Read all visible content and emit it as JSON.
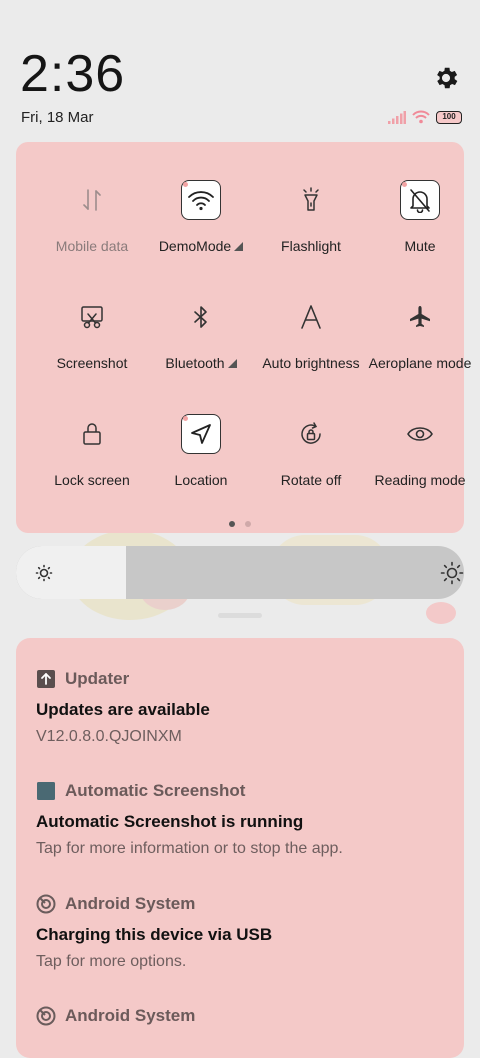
{
  "header": {
    "time": "2:36",
    "date": "Fri, 18 Mar",
    "battery_level": "100"
  },
  "quick_settings": {
    "tiles": [
      {
        "label": "Mobile data",
        "icon": "mobile-data-icon",
        "active": false,
        "dim": true,
        "expandable": false
      },
      {
        "label": "DemoMode",
        "icon": "wifi-icon",
        "active": true,
        "dim": false,
        "expandable": true
      },
      {
        "label": "Flashlight",
        "icon": "flashlight-icon",
        "active": false,
        "dim": false,
        "expandable": false
      },
      {
        "label": "Mute",
        "icon": "bell-off-icon",
        "active": true,
        "dim": false,
        "expandable": false
      },
      {
        "label": "Screenshot",
        "icon": "scissors-icon",
        "active": false,
        "dim": false,
        "expandable": false
      },
      {
        "label": "Bluetooth",
        "icon": "bluetooth-icon",
        "active": false,
        "dim": false,
        "expandable": true
      },
      {
        "label": "Auto brightness",
        "icon": "auto-brightness-icon",
        "active": false,
        "dim": false,
        "expandable": false
      },
      {
        "label": "Aeroplane mode",
        "icon": "airplane-icon",
        "active": false,
        "dim": false,
        "expandable": false
      },
      {
        "label": "Lock screen",
        "icon": "lock-icon",
        "active": false,
        "dim": false,
        "expandable": false
      },
      {
        "label": "Location",
        "icon": "location-arrow-icon",
        "active": true,
        "dim": false,
        "expandable": false
      },
      {
        "label": "Rotate off",
        "icon": "rotate-lock-icon",
        "active": false,
        "dim": false,
        "expandable": false
      },
      {
        "label": "Reading mode",
        "icon": "eye-icon",
        "active": false,
        "dim": false,
        "expandable": false
      }
    ],
    "page_count": 2,
    "current_page": 1
  },
  "brightness": {
    "level": 0.2
  },
  "notifications": [
    {
      "app": "Updater",
      "icon": "updater-arrow-icon",
      "title": "Updates are available",
      "body": "V12.0.8.0.QJOINXM"
    },
    {
      "app": "Automatic Screenshot",
      "icon": "app-square-icon",
      "title": "Automatic Screenshot is running",
      "body": "Tap for more information or to stop the app."
    },
    {
      "app": "Android System",
      "icon": "android-system-icon",
      "title": "Charging this device via USB",
      "body": "Tap for more options."
    },
    {
      "app": "Android System",
      "icon": "android-system-icon",
      "title": "",
      "body": ""
    }
  ],
  "colors": {
    "panel": "#f4c9c8",
    "background": "#ebebeb",
    "app_name": "#6b5a5a"
  }
}
